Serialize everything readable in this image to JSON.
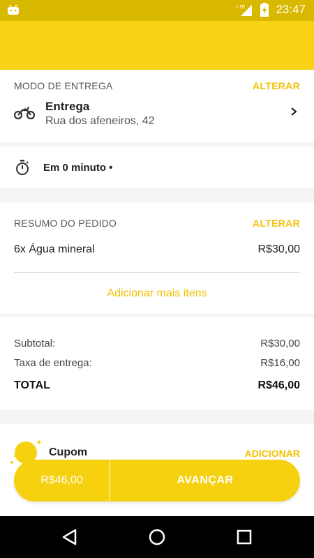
{
  "status_bar": {
    "network": "LTE",
    "time": "23:47"
  },
  "delivery": {
    "section_title": "MODO DE ENTREGA",
    "action_label": "ALTERAR",
    "mode": "Entrega",
    "address": "Rua dos afeneiros, 42",
    "time_text": "Em 0 minuto •"
  },
  "order": {
    "section_title": "RESUMO DO PEDIDO",
    "action_label": "ALTERAR",
    "items": [
      {
        "name": "6x Água mineral",
        "price": "R$30,00"
      }
    ],
    "add_more_label": "Adicionar mais itens"
  },
  "summary": {
    "subtotal_label": "Subtotal:",
    "subtotal_value": "R$30,00",
    "fee_label": "Taxa de entrega:",
    "fee_value": "R$16,00",
    "total_label": "TOTAL",
    "total_value": "R$46,00"
  },
  "coupon": {
    "label": "Cupom",
    "action_label": "ADICIONAR"
  },
  "footer_button": {
    "amount": "R$46,00",
    "action_label": "AVANÇAR"
  },
  "colors": {
    "brand_yellow": "#f7d215",
    "accent_text": "#f2c200",
    "status_bar": "#d9b900"
  },
  "icons": {
    "status_left": "android-icon",
    "signal": "signal-icon",
    "battery": "battery-charging-icon",
    "delivery": "motorcycle-icon",
    "chevron": "chevron-right-icon",
    "timer": "stopwatch-icon",
    "coupon": "coupon-sparkle-icon",
    "nav": [
      "back-icon",
      "home-icon",
      "recents-icon"
    ]
  }
}
